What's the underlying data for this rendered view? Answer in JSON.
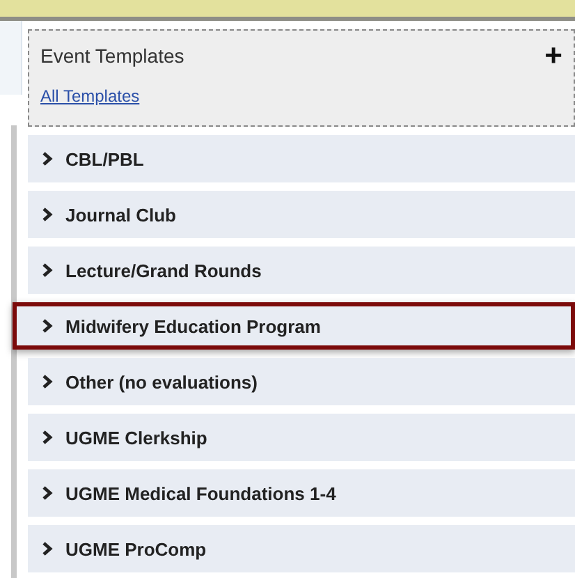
{
  "panel": {
    "title": "Event Templates",
    "add_button": "+",
    "link": "All Templates"
  },
  "groups": [
    {
      "label": "CBL/PBL",
      "highlighted": false
    },
    {
      "label": "Journal Club",
      "highlighted": false
    },
    {
      "label": "Lecture/Grand Rounds",
      "highlighted": false
    },
    {
      "label": "Midwifery Education Program",
      "highlighted": true
    },
    {
      "label": "Other (no evaluations)",
      "highlighted": false
    },
    {
      "label": "UGME Clerkship",
      "highlighted": false
    },
    {
      "label": "UGME Medical Foundations 1-4",
      "highlighted": false
    },
    {
      "label": "UGME ProComp",
      "highlighted": false
    }
  ]
}
